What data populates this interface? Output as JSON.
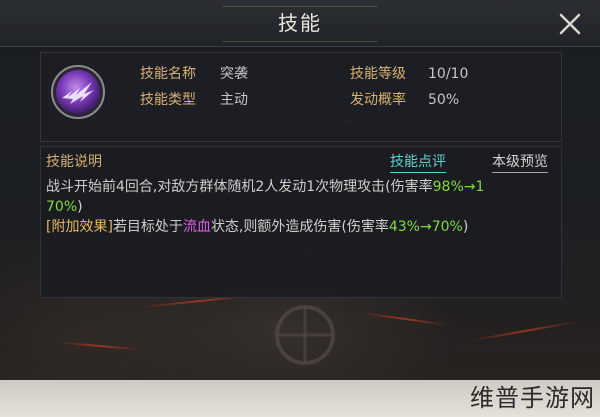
{
  "header": {
    "title": "技能"
  },
  "skill": {
    "icon": "purple-slash-emblem-icon",
    "fields": {
      "name_label": "技能名称",
      "name_value": "突袭",
      "level_label": "技能等级",
      "level_value": "10/10",
      "type_label": "技能类型",
      "type_value": "主动",
      "rate_label": "发动概率",
      "rate_value": "50%"
    }
  },
  "description": {
    "heading": "技能说明",
    "tabs": {
      "review": "技能点评",
      "preview": "本级预览"
    },
    "line1_text": "战斗开始前4回合,对敌方群体随机2人发动1次物理攻击(伤害率",
    "line1_highlight": "98%→1",
    "line2_highlight": "70%",
    "line2_text": ")",
    "line3_tag": "[附加效果]",
    "line3_text_a": "若目标处于",
    "line3_status": "流血",
    "line3_text_b": "状态,则额外造成伤害(伤害率",
    "line3_highlight": "43%→70%",
    "line3_text_c": ")"
  },
  "watermark": "维普手游网",
  "colors": {
    "label_gold": "#d6b073",
    "highlight_green": "#7fdc3c",
    "tag_yellow": "#e6b85a",
    "status_magenta": "#e15ee6",
    "tab_cyan": "#5fd3cf"
  }
}
